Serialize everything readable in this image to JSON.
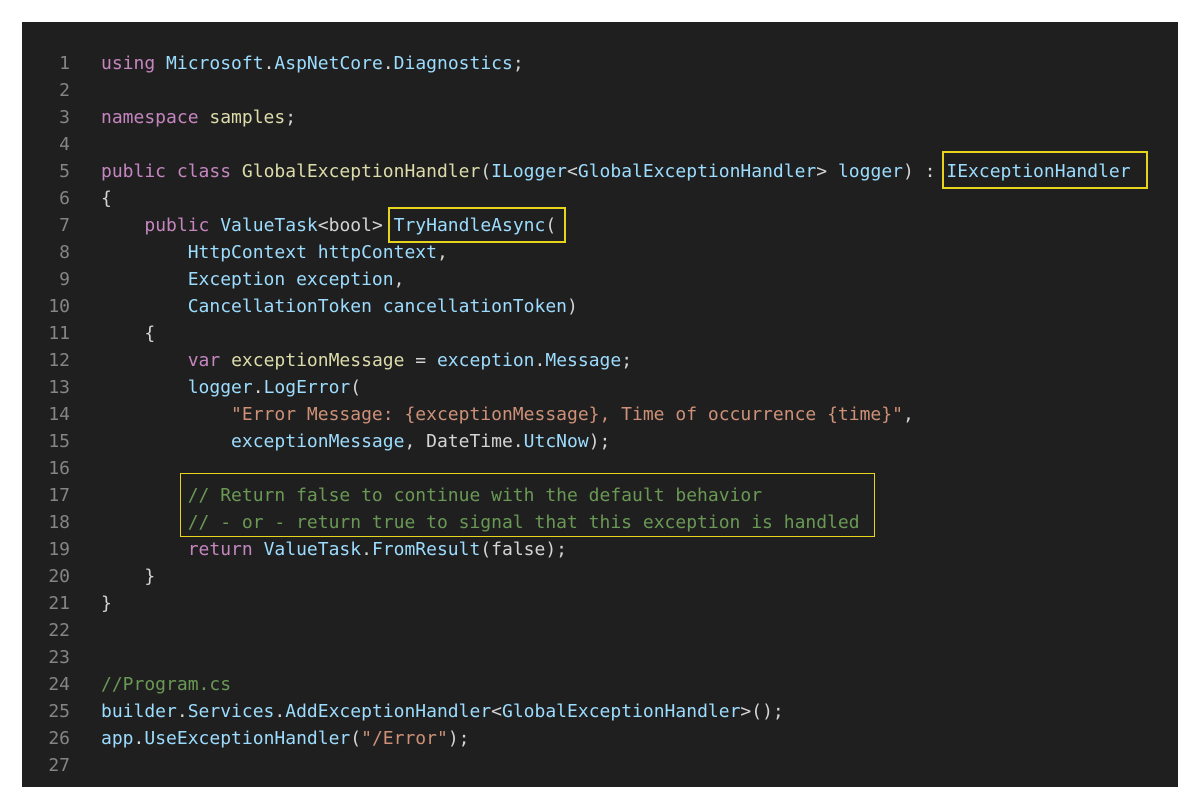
{
  "lines": [
    {
      "n": "1",
      "t": [
        {
          "c": "kw",
          "s": "using "
        },
        {
          "c": "ty",
          "s": "Microsoft"
        },
        {
          "c": "pl",
          "s": "."
        },
        {
          "c": "ty",
          "s": "AspNetCore"
        },
        {
          "c": "pl",
          "s": "."
        },
        {
          "c": "ty",
          "s": "Diagnostics"
        },
        {
          "c": "pl",
          "s": ";"
        }
      ]
    },
    {
      "n": "2",
      "t": []
    },
    {
      "n": "3",
      "t": [
        {
          "c": "kw",
          "s": "namespace "
        },
        {
          "c": "fn",
          "s": "samples"
        },
        {
          "c": "pl",
          "s": ";"
        }
      ]
    },
    {
      "n": "4",
      "t": []
    },
    {
      "n": "5",
      "t": [
        {
          "c": "kw",
          "s": "public class "
        },
        {
          "c": "fn",
          "s": "GlobalExceptionHandler"
        },
        {
          "c": "pl",
          "s": "("
        },
        {
          "c": "ty",
          "s": "ILogger"
        },
        {
          "c": "pl",
          "s": "<"
        },
        {
          "c": "ty",
          "s": "GlobalExceptionHandler"
        },
        {
          "c": "pl",
          "s": "> "
        },
        {
          "c": "ty",
          "s": "logger"
        },
        {
          "c": "pl",
          "s": ") : "
        },
        {
          "c": "ty",
          "s": "IExceptionHandler"
        }
      ]
    },
    {
      "n": "6",
      "t": [
        {
          "c": "pl",
          "s": "{"
        }
      ]
    },
    {
      "n": "7",
      "t": [
        {
          "c": "pl",
          "s": "    "
        },
        {
          "c": "kw",
          "s": "public "
        },
        {
          "c": "ty",
          "s": "ValueTask"
        },
        {
          "c": "pl",
          "s": "<bool> "
        },
        {
          "c": "ty",
          "s": "TryHandleAsync"
        },
        {
          "c": "pl",
          "s": "("
        }
      ]
    },
    {
      "n": "8",
      "t": [
        {
          "c": "pl",
          "s": "        "
        },
        {
          "c": "ty",
          "s": "HttpContext httpContext"
        },
        {
          "c": "pl",
          "s": ","
        }
      ]
    },
    {
      "n": "9",
      "t": [
        {
          "c": "pl",
          "s": "        "
        },
        {
          "c": "ty",
          "s": "Exception exception"
        },
        {
          "c": "pl",
          "s": ","
        }
      ]
    },
    {
      "n": "10",
      "t": [
        {
          "c": "pl",
          "s": "        "
        },
        {
          "c": "ty",
          "s": "CancellationToken cancellationToken"
        },
        {
          "c": "pl",
          "s": ")"
        }
      ]
    },
    {
      "n": "11",
      "t": [
        {
          "c": "pl",
          "s": "    {"
        }
      ]
    },
    {
      "n": "12",
      "t": [
        {
          "c": "pl",
          "s": "        "
        },
        {
          "c": "kw",
          "s": "var "
        },
        {
          "c": "fn",
          "s": "exceptionMessage"
        },
        {
          "c": "pl",
          "s": " = "
        },
        {
          "c": "ty",
          "s": "exception"
        },
        {
          "c": "pl",
          "s": "."
        },
        {
          "c": "ty",
          "s": "Message"
        },
        {
          "c": "pl",
          "s": ";"
        }
      ]
    },
    {
      "n": "13",
      "t": [
        {
          "c": "pl",
          "s": "        "
        },
        {
          "c": "ty",
          "s": "logger"
        },
        {
          "c": "pl",
          "s": "."
        },
        {
          "c": "ty",
          "s": "LogError"
        },
        {
          "c": "pl",
          "s": "("
        }
      ]
    },
    {
      "n": "14",
      "t": [
        {
          "c": "pl",
          "s": "            "
        },
        {
          "c": "str",
          "s": "\"Error Message: {exceptionMessage}, Time of occurrence {time}\""
        },
        {
          "c": "pl",
          "s": ","
        }
      ]
    },
    {
      "n": "15",
      "t": [
        {
          "c": "pl",
          "s": "            "
        },
        {
          "c": "ty",
          "s": "exceptionMessage"
        },
        {
          "c": "pl",
          "s": ", DateTime."
        },
        {
          "c": "ty",
          "s": "UtcNow"
        },
        {
          "c": "pl",
          "s": ");"
        }
      ]
    },
    {
      "n": "16",
      "t": []
    },
    {
      "n": "17",
      "t": [
        {
          "c": "pl",
          "s": "        "
        },
        {
          "c": "cm",
          "s": "// Return false to continue with the default behavior"
        }
      ]
    },
    {
      "n": "18",
      "t": [
        {
          "c": "pl",
          "s": "        "
        },
        {
          "c": "cm",
          "s": "// - or - return true to signal that this exception is handled"
        }
      ]
    },
    {
      "n": "19",
      "t": [
        {
          "c": "pl",
          "s": "        "
        },
        {
          "c": "kw",
          "s": "return "
        },
        {
          "c": "ty",
          "s": "ValueTask"
        },
        {
          "c": "pl",
          "s": "."
        },
        {
          "c": "ty",
          "s": "FromResult"
        },
        {
          "c": "pl",
          "s": "(false);"
        }
      ]
    },
    {
      "n": "20",
      "t": [
        {
          "c": "pl",
          "s": "    }"
        }
      ]
    },
    {
      "n": "21",
      "t": [
        {
          "c": "pl",
          "s": "}"
        }
      ]
    },
    {
      "n": "22",
      "t": []
    },
    {
      "n": "23",
      "t": []
    },
    {
      "n": "24",
      "t": [
        {
          "c": "cm",
          "s": "//Program.cs"
        }
      ]
    },
    {
      "n": "25",
      "t": [
        {
          "c": "ty",
          "s": "builder"
        },
        {
          "c": "pl",
          "s": "."
        },
        {
          "c": "ty",
          "s": "Services"
        },
        {
          "c": "pl",
          "s": "."
        },
        {
          "c": "ty",
          "s": "AddExceptionHandler"
        },
        {
          "c": "pl",
          "s": "<"
        },
        {
          "c": "ty",
          "s": "GlobalExceptionHandler"
        },
        {
          "c": "pl",
          "s": ">();"
        }
      ]
    },
    {
      "n": "26",
      "t": [
        {
          "c": "ty",
          "s": "app"
        },
        {
          "c": "pl",
          "s": "."
        },
        {
          "c": "ty",
          "s": "UseExceptionHandler"
        },
        {
          "c": "pl",
          "s": "("
        },
        {
          "c": "str",
          "s": "\"/Error\""
        },
        {
          "c": "pl",
          "s": ");"
        }
      ]
    },
    {
      "n": "27",
      "t": []
    }
  ]
}
